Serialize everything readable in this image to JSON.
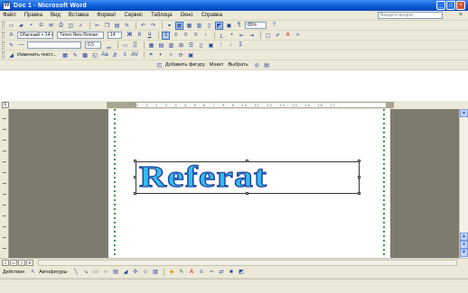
{
  "window": {
    "title": "Doc 1 - Microsoft Word",
    "controls": [
      "_",
      "□",
      "×"
    ]
  },
  "menubar": {
    "items": [
      "Файл",
      "Правка",
      "Вид",
      "Вставка",
      "Формат",
      "Сервис",
      "Таблица",
      "Окно",
      "Справка"
    ],
    "help_placeholder": "Введите вопрос",
    "close_doc": "×"
  },
  "toolbars": {
    "standard_zoom": "85%",
    "formatting": {
      "style": "Обычный + 14 пт",
      "font": "Times New Roman",
      "size": "14"
    },
    "wordart": {
      "weight": "0,5",
      "reviewing": "Изменить текст..."
    },
    "picture": {
      "add_shape": "Добавить фигуру",
      "layout": "Макет",
      "select": "Выбрать"
    }
  },
  "ruler": {
    "ticks": "1 · 2 · 1 · 2 · 3 · 4 · 5 · 6 · 7 · 8 · 9 · 10 · 11 · 12 · 13 · 14 · 15 · 16 · 17 ·"
  },
  "document": {
    "wordart_text": "Referat"
  },
  "drawing_toolbar": {
    "actions": "Действия",
    "autoshapes": "Автофигуры"
  },
  "colors": {
    "wordart_fill": "#33bdf0",
    "wordart_outline": "#1f3f9c",
    "page_border": "#3f8f4f",
    "workspace": "#7d7b70",
    "titlebar": "#0a5ad8"
  },
  "icons": [
    "word-icon",
    "new-icon",
    "open-icon",
    "save-icon",
    "print-icon",
    "cut-icon",
    "copy-icon",
    "paste-icon",
    "undo-icon",
    "redo-icon",
    "bold-icon",
    "italic-icon",
    "underline-icon",
    "align-left-icon",
    "align-center-icon",
    "align-right-icon",
    "justify-icon",
    "bullets-icon",
    "numbering-icon",
    "font-color-icon",
    "highlight-icon",
    "line-icon",
    "arrow-icon",
    "rectangle-icon",
    "oval-icon",
    "textbox-icon",
    "wordart-icon"
  ]
}
